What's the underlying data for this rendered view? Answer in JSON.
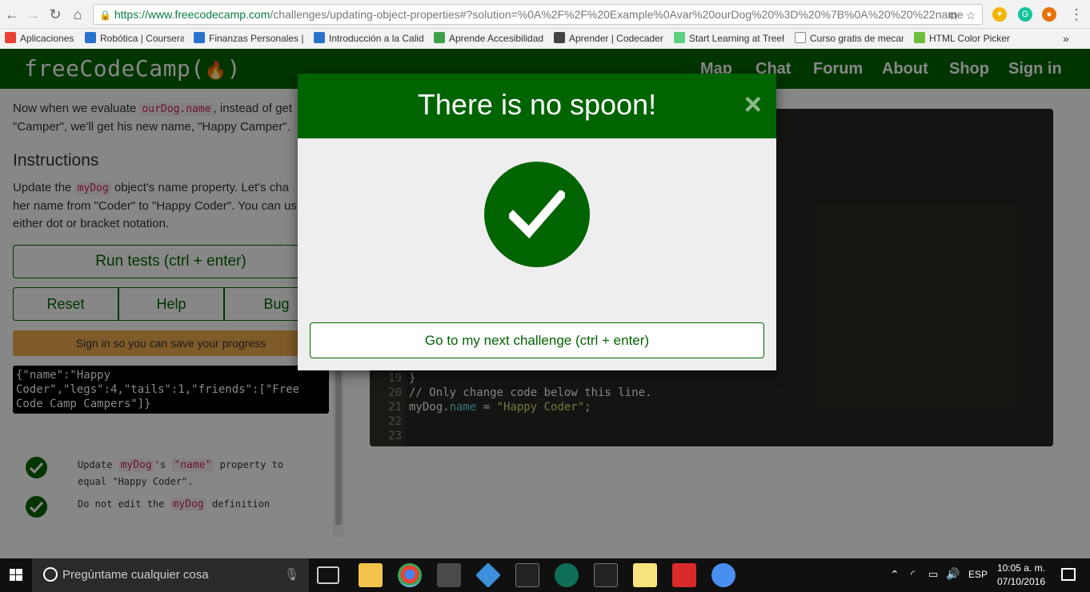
{
  "browser": {
    "url_scheme": "https://",
    "url_host": "www.freecodecamp.com",
    "url_path": "/challenges/updating-object-properties#?solution=%0A%2F%2F%20Example%0Avar%20ourDog%20%3D%20%7B%0A%20%20%22name",
    "bookmarks": [
      {
        "label": "Aplicaciones",
        "color": "#e94235"
      },
      {
        "label": "Robótica | Coursera",
        "color": "#2a73cc"
      },
      {
        "label": "Finanzas Personales | (",
        "color": "#2a73cc"
      },
      {
        "label": "Introducción a la Calid",
        "color": "#2a73cc"
      },
      {
        "label": "Aprende Accesibilidad",
        "color": "#3fa24a"
      },
      {
        "label": "Aprender | Codecader",
        "color": "#444444"
      },
      {
        "label": "Start Learning at Treeh",
        "color": "#5fcf80"
      },
      {
        "label": "Curso gratis de mecan",
        "color": "#888888"
      },
      {
        "label": "HTML Color Picker",
        "color": "#6cbf3a"
      }
    ],
    "bookmarks_more": "»"
  },
  "fcc": {
    "logo": "freeCodeCamp(",
    "logo_end": ")",
    "nav": [
      "Map",
      "Chat",
      "Forum",
      "About",
      "Shop",
      "Sign in"
    ]
  },
  "left": {
    "desc_line1_pre": "Now when we evaluate ",
    "desc_line1_code": "ourDog.name",
    "desc_line1_post": ", instead of get",
    "desc_line2": "\"Camper\", we'll get his new name, \"Happy Camper\".",
    "instructions_title": "Instructions",
    "instr_pre": "Update the ",
    "instr_code": "myDog",
    "instr_l1_post": " object's name property. Let's cha",
    "instr_l2": "her name from \"Coder\" to \"Happy Coder\". You can us",
    "instr_l3": "either dot or bracket notation.",
    "run_tests": "Run tests (ctrl + enter)",
    "reset": "Reset",
    "help": "Help",
    "bug": "Bug",
    "signin_notice": "Sign in so you can save your progress",
    "output_l1": "{\"name\":\"Happy",
    "output_l2": "Coder\",\"legs\":4,\"tails\":1,\"friends\":[\"Free",
    "output_l3": "Code Camp Campers\"]}",
    "test1_pre": "Update ",
    "test1_code1": "myDog",
    "test1_mid": "'s ",
    "test1_code2": "\"name\"",
    "test1_post": " property to",
    "test1_l2": "equal \"Happy Coder\".",
    "test2_pre": "Do not edit the ",
    "test2_code": "myDog",
    "test2_post": " definition"
  },
  "editor": {
    "lines": [
      {
        "n": "19",
        "text": "}"
      },
      {
        "n": "20",
        "text": "// Only change code below this line."
      },
      {
        "n": "21",
        "var": "myDog.",
        "prop": "name",
        "eq": " = ",
        "str": "\"Happy Coder\"",
        "end": ";"
      },
      {
        "n": "22",
        "text": ""
      },
      {
        "n": "23",
        "text": ""
      }
    ]
  },
  "modal": {
    "title": "There is no spoon!",
    "close": "×",
    "next_button": "Go to my next challenge (ctrl + enter)"
  },
  "taskbar": {
    "search_placeholder": "Pregúntame cualquier cosa",
    "lang": "ESP",
    "time": "10:05 a. m.",
    "date": "07/10/2016"
  }
}
